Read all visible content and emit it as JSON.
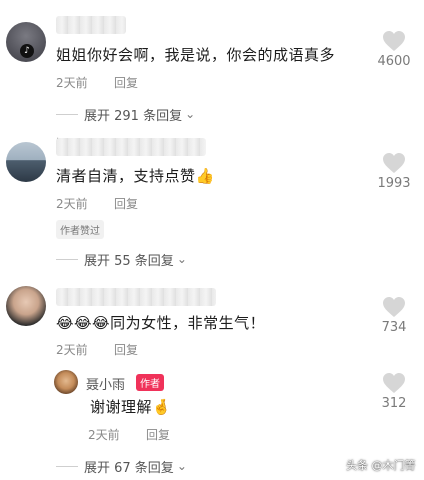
{
  "comments": [
    {
      "text": "姐姐你好会啊，我是说，你会的成语真多",
      "time": "2天前",
      "reply_label": "回复",
      "likes": "4600",
      "expand_label": "展开 291 条回复",
      "avatar_badge": "♪"
    },
    {
      "text": "清者自清，支持点赞",
      "emoji": "👍",
      "time": "2天前",
      "reply_label": "回复",
      "likes": "1993",
      "author_liked": "作者赞过",
      "expand_label": "展开 55 条回复",
      "name_mark": "·"
    },
    {
      "emoji": "😂😂😂",
      "text": "同为女性，非常生气！",
      "time": "2天前",
      "reply_label": "回复",
      "likes": "734",
      "reply": {
        "name": "聂小雨",
        "tag": "作者",
        "text": "谢谢理解",
        "emoji": "🤞",
        "time": "2天前",
        "reply_label": "回复",
        "likes": "312"
      },
      "expand_label": "展开 67 条回复"
    }
  ],
  "watermark": "头条 @木门箐",
  "chevron": "⌄",
  "colors": {
    "author_tag": "#f0325a",
    "meta": "#8a8a8a",
    "heart": "#d6d6d6"
  }
}
